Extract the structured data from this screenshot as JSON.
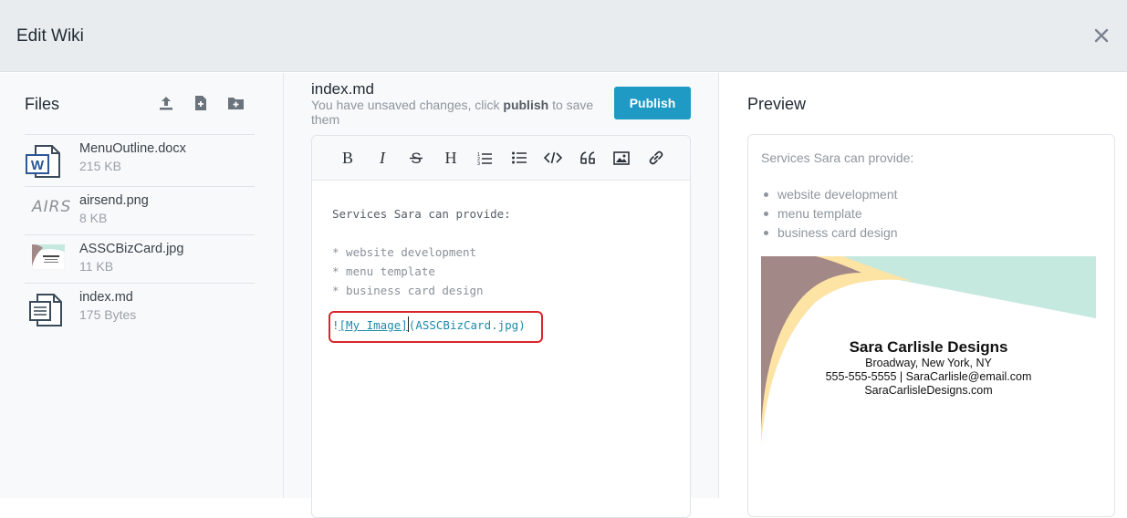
{
  "header": {
    "title": "Edit Wiki",
    "close_icon": "close-icon"
  },
  "files": {
    "title": "Files",
    "tools": [
      "upload-icon",
      "new-file-icon",
      "new-folder-icon"
    ],
    "items": [
      {
        "name": "MenuOutline.docx",
        "size": "215 KB",
        "icon": "word-doc-icon"
      },
      {
        "name": "airsend.png",
        "size": "8 KB",
        "thumb_text": "AIRS",
        "icon": "image-thumbnail"
      },
      {
        "name": "ASSCBizCard.jpg",
        "size": "11 KB",
        "icon": "image-thumbnail"
      },
      {
        "name": "index.md",
        "size": "175 Bytes",
        "icon": "document-icon"
      }
    ]
  },
  "editor": {
    "doc_title": "index.md",
    "note_prefix": "You have unsaved changes, click ",
    "note_bold": "publish",
    "note_suffix": " to save them",
    "publish_label": "Publish",
    "toolbar": [
      "bold-icon",
      "italic-icon",
      "strikethrough-icon",
      "heading-icon",
      "ordered-list-icon",
      "unordered-list-icon",
      "code-icon",
      "quote-icon",
      "image-icon",
      "link-icon"
    ],
    "lines": {
      "intro": "Services Sara can provide:",
      "b1": "* website development",
      "b2": "* menu template",
      "b3": "* business card design",
      "img_bang": "!",
      "img_alt": "[My Image]",
      "img_src": "(ASSCBizCard.jpg)"
    }
  },
  "preview": {
    "title": "Preview",
    "intro": "Services Sara can provide:",
    "bullets": [
      "website development",
      "menu template",
      "business card design"
    ],
    "card": {
      "name": "Sara Carlisle Designs",
      "address": "Broadway, New York, NY",
      "contact": "555-555-5555 | SaraCarlisle@email.com",
      "website": "SaraCarlisleDesigns.com"
    }
  },
  "colors": {
    "accent": "#1e9ac4",
    "highlight": "#d9262c",
    "card_mauve": "#a38888",
    "card_cream": "#fde4a5",
    "card_mint": "#c5e8df"
  }
}
